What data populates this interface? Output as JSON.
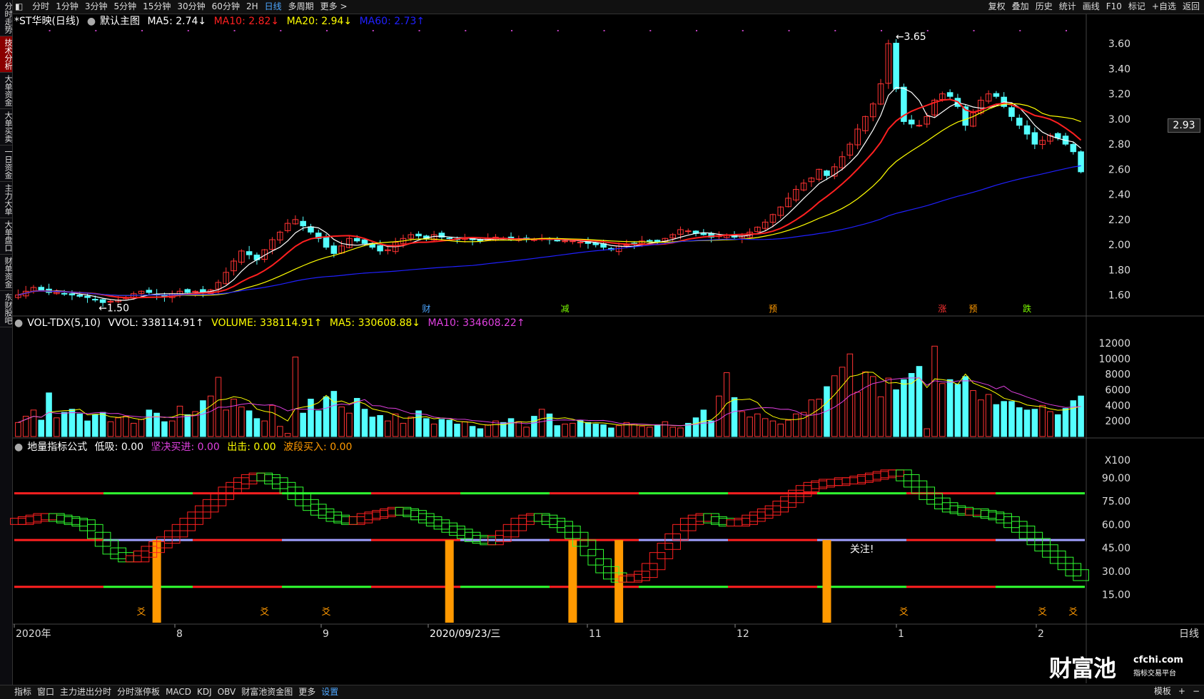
{
  "left_tabs": [
    "分时走势",
    "技术分析",
    "大单资金",
    "大单买卖",
    "一日资金",
    "主力大单",
    "大单盘口",
    "财单资金",
    "东财股吧"
  ],
  "left_active": 1,
  "top_periods": [
    "分时",
    "1分钟",
    "3分钟",
    "5分钟",
    "15分钟",
    "30分钟",
    "60分钟",
    "2H",
    "日线",
    "多周期",
    "更多 >"
  ],
  "top_active": "日线",
  "top_right": [
    "复权",
    "叠加",
    "历史",
    "统计",
    "画线",
    "F10",
    "标记",
    "+自选",
    "返回"
  ],
  "main_legend": {
    "stock": "*ST华映(日线)",
    "chart_name": "默认主图",
    "ma5": "MA5: 2.74↓",
    "ma10": "MA10: 2.82↓",
    "ma20": "MA20: 2.94↓",
    "ma60": "MA60: 2.73↑"
  },
  "vol_legend": {
    "name": "VOL-TDX(5,10)",
    "vvol": "VVOL: 338114.91↑",
    "volume": "VOLUME: 338114.91↑",
    "ma5": "MA5: 330608.88↓",
    "ma10": "MA10: 334608.22↑"
  },
  "ind_legend": {
    "name": "地量指标公式",
    "low": "低吸: 0.00",
    "firm": "坚决买进: 0.00",
    "hit": "出击: 0.00",
    "wave": "波段买入: 0.00"
  },
  "annotations": {
    "high": "3.65",
    "low": "1.50",
    "current_price": "2.93",
    "focus": "关注!",
    "markers": [
      {
        "label": "财",
        "color": "#4da6ff"
      },
      {
        "label": "减",
        "color": "#7cfc00"
      },
      {
        "label": "预",
        "color": "#ff9900"
      },
      {
        "label": "涨",
        "color": "#ff3333"
      },
      {
        "label": "预",
        "color": "#ff9900"
      },
      {
        "label": "跌",
        "color": "#7cfc00"
      }
    ]
  },
  "x_axis": {
    "labels": [
      "2020年",
      "8",
      "9",
      "2020/09/23/三",
      "11",
      "12",
      "1",
      "2"
    ],
    "period": "日线"
  },
  "bottom_tabs": [
    "指标",
    "窗口",
    "主力进出分时",
    "分时涨停板",
    "MACD",
    "KDJ",
    "OBV",
    "财富池资金图",
    "更多",
    "设置"
  ],
  "bottom_active": "设置",
  "bottom_right": [
    "模板",
    "+",
    "−"
  ],
  "watermark": {
    "brand": "财富池",
    "site": "cfchi.com",
    "tagline": "指标交易平台"
  },
  "colors": {
    "up": "#ff3333",
    "down": "#54ffff",
    "ma5": "#ffffff",
    "ma10": "#ff2020",
    "ma20": "#ffff00",
    "ma60": "#2020ff"
  },
  "chart_data": [
    {
      "type": "candlestick",
      "title": "*ST华映(日线)",
      "y_ticks": [
        3.6,
        3.4,
        3.2,
        3.0,
        2.8,
        2.6,
        2.4,
        2.2,
        2.0,
        1.8,
        1.6
      ],
      "ylim": [
        1.45,
        3.72
      ],
      "close": [
        1.6,
        1.63,
        1.66,
        1.64,
        1.62,
        1.62,
        1.61,
        1.6,
        1.59,
        1.58,
        1.56,
        1.54,
        1.55,
        1.56,
        1.58,
        1.61,
        1.63,
        1.62,
        1.6,
        1.59,
        1.61,
        1.63,
        1.62,
        1.63,
        1.62,
        1.64,
        1.7,
        1.78,
        1.87,
        1.95,
        1.92,
        1.88,
        1.96,
        2.04,
        2.1,
        2.17,
        2.2,
        2.15,
        2.1,
        2.05,
        1.98,
        1.93,
        1.99,
        2.05,
        2.03,
        2.01,
        1.98,
        1.95,
        1.96,
        2.02,
        2.05,
        2.08,
        2.07,
        2.05,
        2.08,
        2.06,
        2.05,
        2.04,
        2.05,
        2.04,
        2.03,
        2.05,
        2.06,
        2.05,
        2.04,
        2.04,
        2.05,
        2.04,
        2.05,
        2.04,
        2.03,
        2.03,
        2.03,
        2.02,
        2.01,
        2.0,
        1.98,
        1.96,
        1.99,
        2.0,
        2.01,
        2.03,
        2.03,
        2.02,
        2.05,
        2.08,
        2.12,
        2.11,
        2.09,
        2.08,
        2.06,
        2.07,
        2.08,
        2.06,
        2.07,
        2.1,
        2.14,
        2.18,
        2.24,
        2.3,
        2.37,
        2.44,
        2.49,
        2.53,
        2.6,
        2.55,
        2.62,
        2.7,
        2.8,
        2.92,
        3.02,
        3.12,
        3.28,
        3.6,
        3.24,
        2.98,
        2.96,
        2.95,
        3.02,
        3.15,
        3.2,
        3.18,
        3.1,
        2.95,
        3.05,
        3.15,
        3.2,
        3.18,
        3.1,
        3.02,
        2.95,
        2.88,
        2.8,
        2.83,
        2.87,
        2.85,
        2.8,
        2.74,
        2.58
      ],
      "series": [
        {
          "name": "MA5",
          "period": 5
        },
        {
          "name": "MA10",
          "period": 10
        },
        {
          "name": "MA20",
          "period": 20
        },
        {
          "name": "MA60",
          "period": 60
        }
      ]
    },
    {
      "type": "bar",
      "title": "VOL-TDX(5,10)",
      "unit": "X100",
      "y_ticks": [
        12000,
        10000,
        8000,
        6000,
        4000,
        2000
      ],
      "ylim": [
        0,
        13000
      ],
      "values": [
        1800,
        2600,
        3400,
        2100,
        5600,
        2400,
        3100,
        3500,
        2900,
        2000,
        2800,
        3100,
        1900,
        2400,
        2600,
        1700,
        2200,
        3400,
        3000,
        1900,
        2000,
        3900,
        2800,
        3200,
        4600,
        5200,
        7600,
        3400,
        4800,
        3800,
        3300,
        2300,
        2000,
        4000,
        1300,
        400,
        10200,
        3000,
        4800,
        3300,
        5100,
        5800,
        3800,
        3000,
        4900,
        3500,
        2500,
        2700,
        2000,
        2900,
        1700,
        2500,
        3300,
        2300,
        1600,
        2200,
        2100,
        1600,
        1900,
        1300,
        1000,
        1500,
        2000,
        1800,
        2300,
        1900,
        1200,
        2600,
        3500,
        2900,
        1400,
        1600,
        1700,
        2100,
        1800,
        1600,
        1500,
        1100,
        1400,
        1800,
        1600,
        1300,
        1200,
        1500,
        1900,
        1200,
        1100,
        1700,
        2400,
        3400,
        2000,
        5200,
        8200,
        5000,
        3200,
        2500,
        2900,
        2300,
        2000,
        1600,
        2100,
        2900,
        3100,
        4700,
        4800,
        6400,
        7800,
        8900,
        10600,
        5700,
        8300,
        7700,
        5100,
        7500,
        6000,
        7300,
        8100,
        9000,
        1000,
        11600,
        6800,
        7300,
        6700,
        7700,
        5900,
        4700,
        5400,
        4100,
        4500,
        4500,
        3700,
        3400,
        3500,
        4000,
        3200,
        2800,
        3600,
        4600,
        5200,
        3300,
        2600,
        3000,
        3400
      ]
    },
    {
      "type": "line",
      "title": "地量指标公式",
      "y_ticks": [
        90.0,
        75.0,
        60.0,
        45.0,
        30.0,
        15.0
      ],
      "ylim": [
        -3,
        105
      ],
      "reference_lines": [
        80,
        50,
        20
      ],
      "values": [
        62,
        63,
        64,
        65,
        65,
        64,
        63,
        62,
        61,
        58,
        53,
        48,
        43,
        40,
        38,
        38,
        41,
        44,
        47,
        50,
        54,
        58,
        62,
        66,
        70,
        74,
        78,
        82,
        85,
        88,
        90,
        91,
        90,
        88,
        85,
        82,
        78,
        74,
        71,
        68,
        66,
        64,
        63,
        62,
        63,
        65,
        66,
        67,
        68,
        69,
        68,
        67,
        65,
        63,
        61,
        59,
        57,
        55,
        53,
        51,
        50,
        49,
        51,
        54,
        58,
        62,
        64,
        65,
        64,
        62,
        60,
        57,
        53,
        48,
        42,
        36,
        31,
        27,
        25,
        25,
        26,
        28,
        33,
        40,
        46,
        52,
        58,
        62,
        64,
        65,
        63,
        62,
        61,
        61,
        62,
        64,
        66,
        68,
        70,
        73,
        76,
        80,
        83,
        85,
        86,
        87,
        87,
        88,
        88,
        89,
        90,
        91,
        92,
        93,
        93,
        90,
        86,
        82,
        78,
        75,
        72,
        70,
        69,
        68,
        68,
        67,
        66,
        65,
        63,
        60,
        57,
        53,
        49,
        45,
        41,
        37,
        33,
        29,
        26,
        23,
        20,
        18
      ],
      "orange_bars_x_index": [
        18,
        56,
        72,
        78,
        105
      ]
    }
  ]
}
